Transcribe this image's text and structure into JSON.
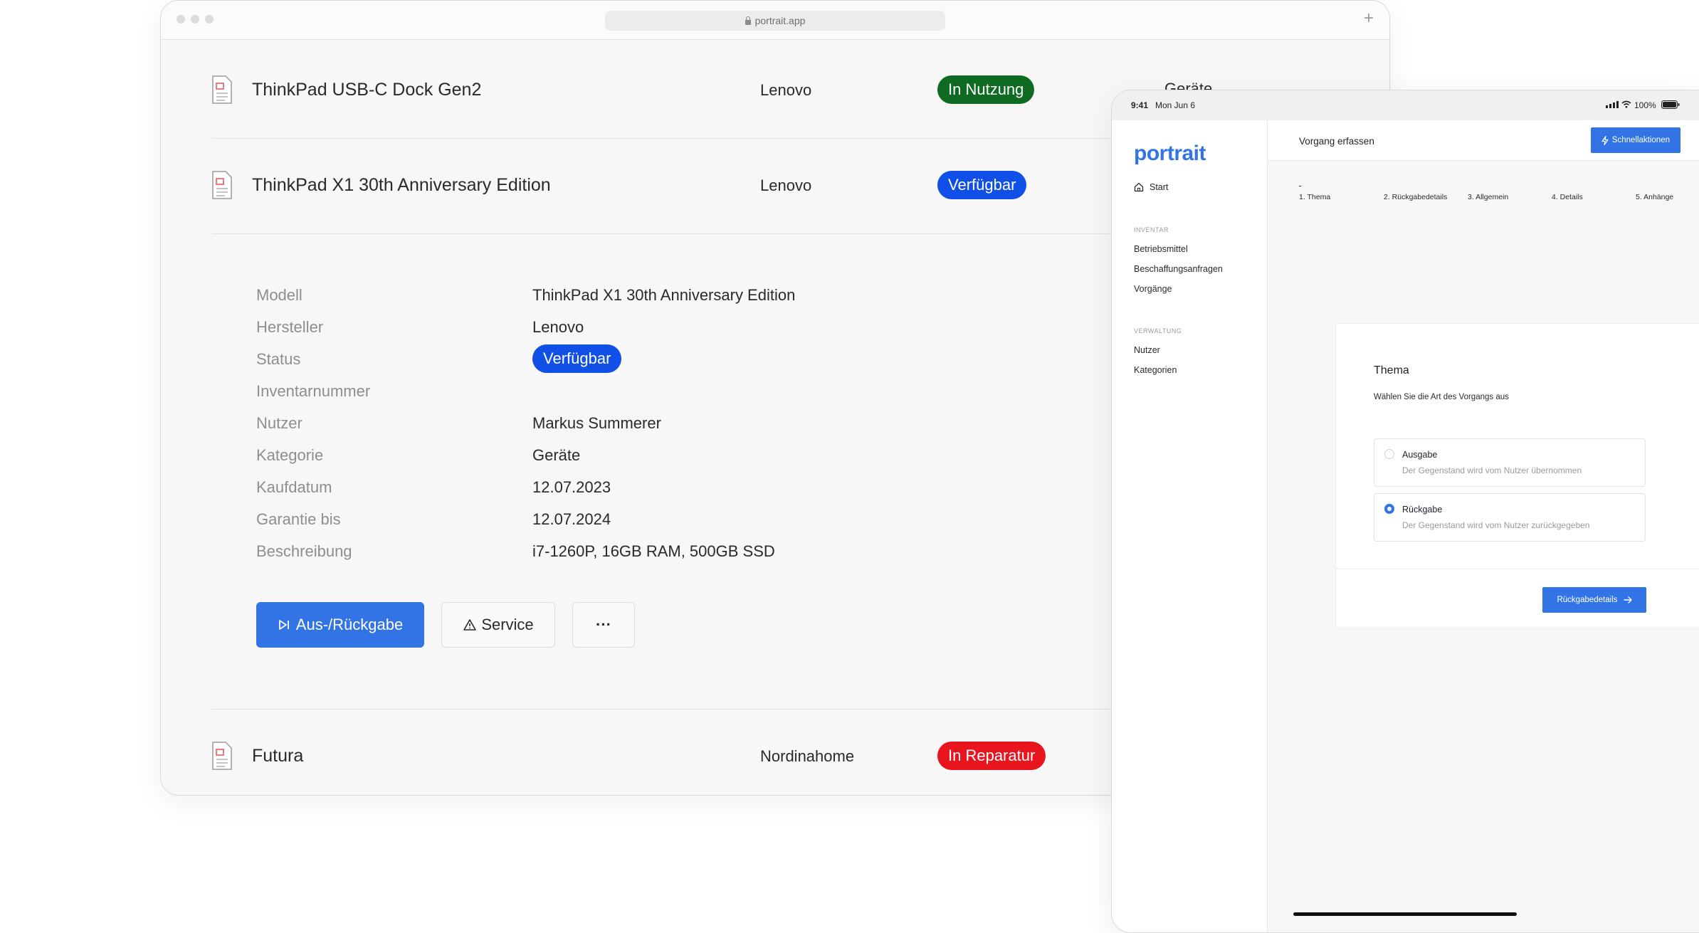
{
  "browser": {
    "url": "portrait.app"
  },
  "list": {
    "rows": [
      {
        "name": "ThinkPad USB-C Dock Gen2",
        "manufacturer": "Lenovo",
        "status": "In Nutzung",
        "category": "Geräte"
      },
      {
        "name": "ThinkPad X1 30th Anniversary Edition",
        "manufacturer": "Lenovo",
        "status": "Verfügbar"
      },
      {
        "name": "Futura",
        "manufacturer": "Nordinahome",
        "status": "In Reparatur"
      }
    ]
  },
  "details": {
    "labels": {
      "model": "Modell",
      "maker": "Hersteller",
      "status": "Status",
      "inventory": "Inventarnummer",
      "user": "Nutzer",
      "category": "Kategorie",
      "purchase": "Kaufdatum",
      "warranty": "Garantie bis",
      "description": "Beschreibung"
    },
    "values": {
      "model": "ThinkPad X1 30th Anniversary Edition",
      "maker": "Lenovo",
      "status": "Verfügbar",
      "inventory": "",
      "user": "Markus Summerer",
      "category": "Geräte",
      "purchase": "12.07.2023",
      "warranty": "12.07.2024",
      "description": "i7-1260P, 16GB RAM, 500GB SSD"
    },
    "actions": {
      "checkout": "Aus-/Rückgabe",
      "service": "Service",
      "more": "···"
    }
  },
  "colors": {
    "accent": "#3274e6",
    "in_use": "#0f6b22",
    "available": "#1150e6",
    "repair": "#e8141e"
  },
  "tablet": {
    "status_bar": {
      "time": "9:41",
      "date": "Mon Jun 6",
      "battery": "100%"
    },
    "logo": "portrait",
    "nav": {
      "start": "Start",
      "section_inventory": "INVENTAR",
      "items_inventory": [
        "Betriebsmittel",
        "Beschaffungsanfragen",
        "Vorgänge"
      ],
      "section_admin": "VERWALTUNG",
      "items_admin": [
        "Nutzer",
        "Kategorien"
      ]
    },
    "header": {
      "title": "Vorgang erfassen",
      "quick_actions": "Schnellaktionen"
    },
    "steps": [
      "1. Thema",
      "2. Rückgabedetails",
      "3. Allgemein",
      "4. Details",
      "5. Anhänge"
    ],
    "card": {
      "title": "Thema",
      "subtitle": "Wählen Sie die Art des Vorgangs aus",
      "options": [
        {
          "title": "Ausgabe",
          "desc": "Der Gegenstand wird vom Nutzer übernommen",
          "selected": false
        },
        {
          "title": "Rückgabe",
          "desc": "Der Gegenstand wird vom Nutzer zurückgegeben",
          "selected": true
        }
      ],
      "next_button": "Rückgabedetails"
    }
  }
}
